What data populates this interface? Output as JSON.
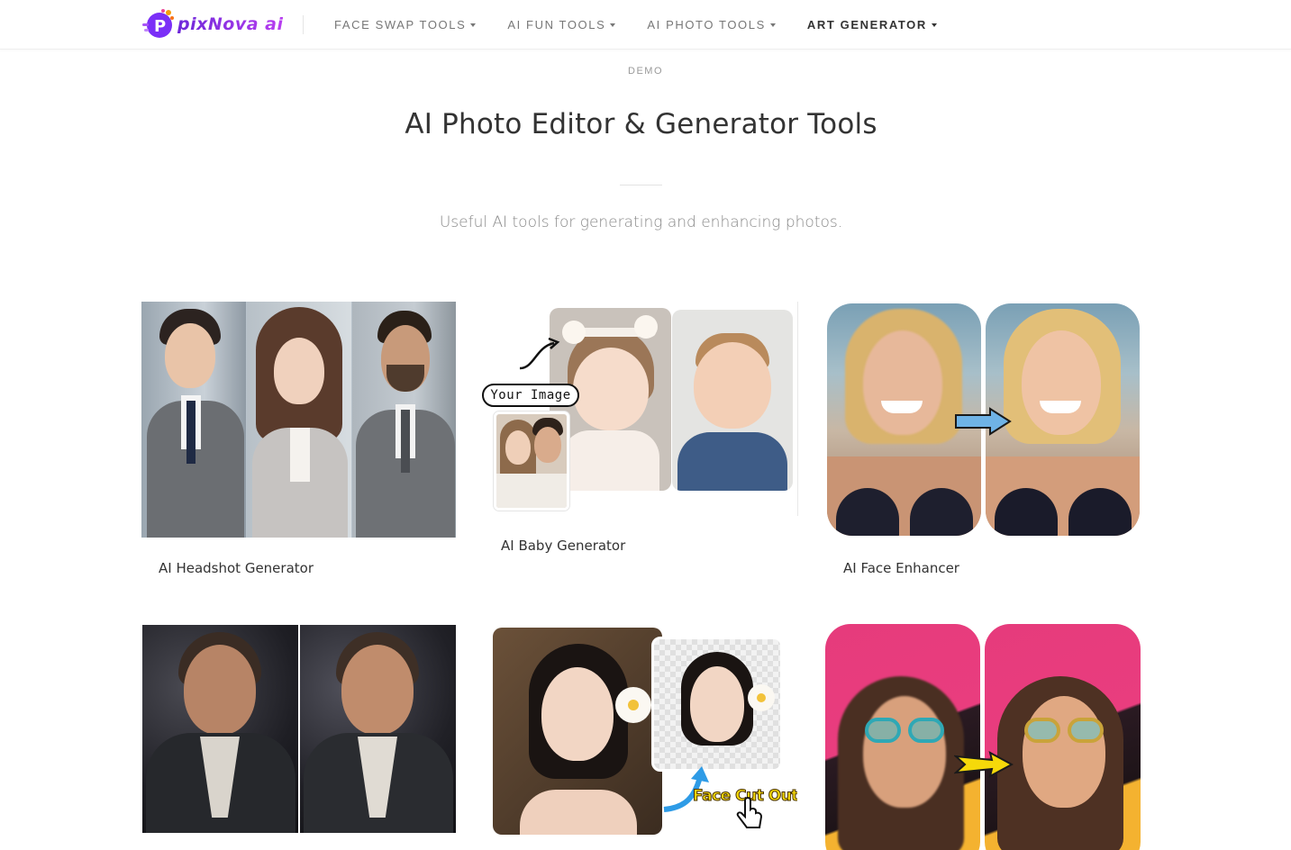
{
  "brand": {
    "name": "PixNova AI",
    "logo_text": "pixNova ai"
  },
  "nav": {
    "items": [
      {
        "label": "FACE SWAP TOOLS",
        "active": false
      },
      {
        "label": "AI FUN TOOLS",
        "active": false
      },
      {
        "label": "AI PHOTO TOOLS",
        "active": false
      },
      {
        "label": "ART GENERATOR",
        "active": true
      }
    ]
  },
  "hero": {
    "eyebrow": "DEMO",
    "title": "AI Photo Editor & Generator Tools",
    "subtitle": "Useful AI tools for generating and enhancing photos."
  },
  "cards": [
    {
      "label": "AI Headshot Generator",
      "icon": "headshot-image"
    },
    {
      "label": "AI Baby Generator",
      "icon": "baby-image",
      "overlay_text": "Your Image"
    },
    {
      "label": "AI Face Enhancer",
      "icon": "face-enhancer-image"
    },
    {
      "label": "",
      "icon": "photo-enhancer-image"
    },
    {
      "label": "",
      "icon": "face-cutout-image",
      "overlay_text": "Face Cut Out"
    },
    {
      "label": "",
      "icon": "glasses-image"
    }
  ],
  "colors": {
    "brand_purple": "#7b2ff7",
    "nav_text": "#777777",
    "nav_active": "#333333",
    "arrow_blue": "#4fa3e0",
    "arrow_yellow": "#f5d90a"
  }
}
